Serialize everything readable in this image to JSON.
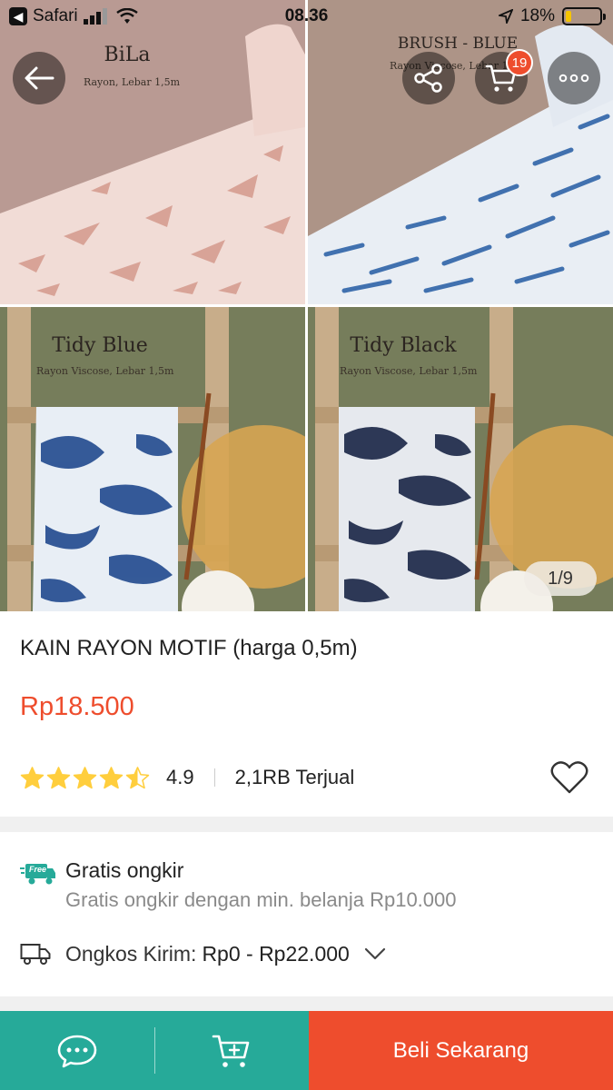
{
  "status_bar": {
    "carrier": "Safari",
    "time": "08.36",
    "battery": "18%",
    "battery_level": 0.18
  },
  "nav": {
    "cart_count": "19"
  },
  "gallery": {
    "counter": "1/9",
    "tiles": [
      {
        "title": "BiLa",
        "subtitle": "Rayon, Lebar 1,5m"
      },
      {
        "title": "BRUSH - BLUE",
        "subtitle": "Rayon Viscose, Lebar 1,5m"
      },
      {
        "title": "Tidy Blue",
        "subtitle": "Rayon Viscose, Lebar 1,5m"
      },
      {
        "title": "Tidy Black",
        "subtitle": "Rayon Viscose, Lebar 1,5m"
      }
    ]
  },
  "product": {
    "title": "KAIN RAYON MOTIF (harga 0,5m)",
    "price": "Rp18.500",
    "rating": "4.9",
    "rating_stars": 4.5,
    "sold": "2,1RB Terjual"
  },
  "shipping": {
    "free_badge": "Free",
    "free_title": "Gratis ongkir",
    "free_subtitle": "Gratis ongkir dengan min. belanja Rp10.000",
    "cost_label": "Ongkos Kirim:",
    "cost_value": "Rp0 - Rp22.000"
  },
  "bottom_bar": {
    "buy_label": "Beli Sekarang"
  },
  "colors": {
    "accent": "#ee4d2d",
    "teal": "#26aa99",
    "star": "#ffce3d"
  }
}
